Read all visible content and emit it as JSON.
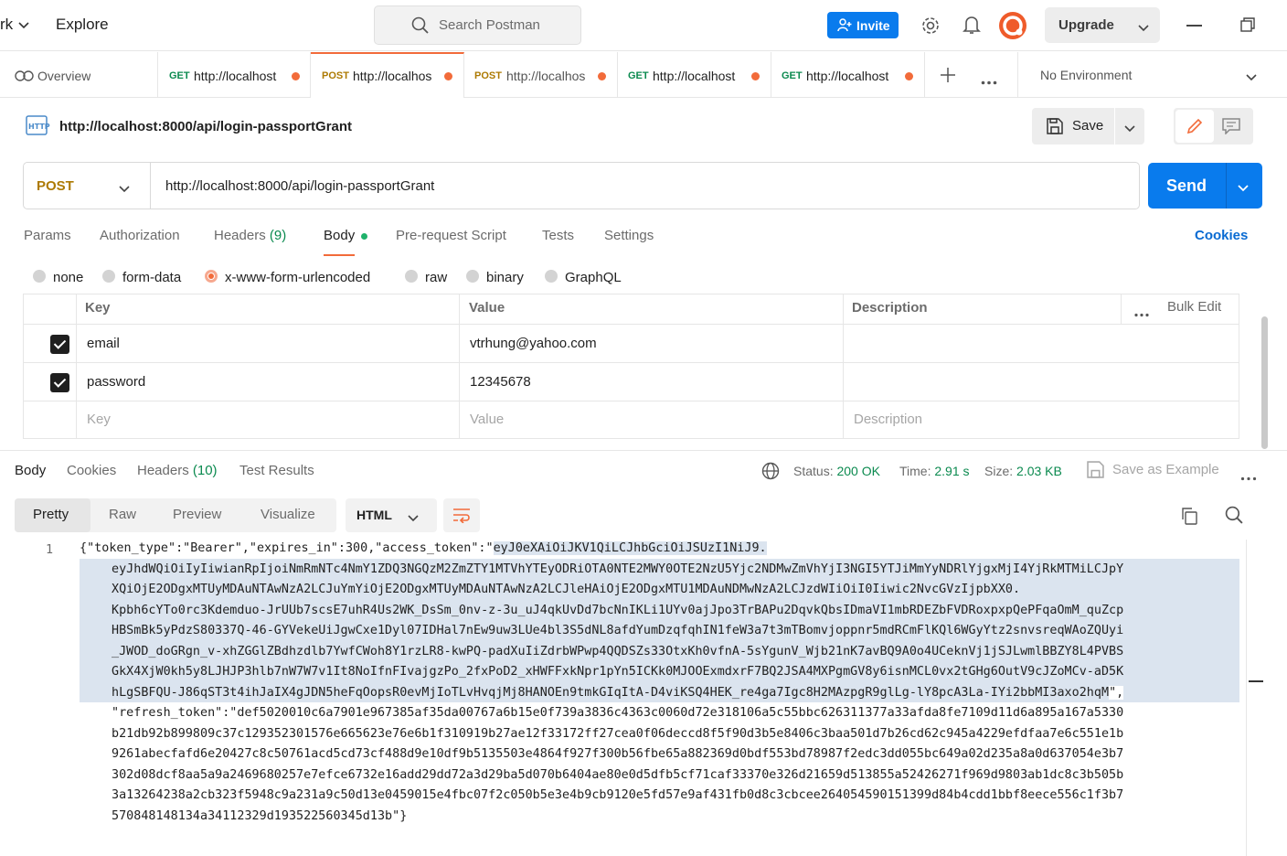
{
  "topbar": {
    "workspace_frag": "rk",
    "explore": "Explore",
    "search_placeholder": "Search Postman",
    "invite": "Invite",
    "upgrade": "Upgrade"
  },
  "tabs": {
    "overview": "Overview",
    "items": [
      {
        "method": "GET",
        "url": "http://localhost"
      },
      {
        "method": "POST",
        "url": "http://localhos"
      },
      {
        "method": "POST",
        "url": "http://localhos"
      },
      {
        "method": "GET",
        "url": "http://localhost"
      },
      {
        "method": "GET",
        "url": "http://localhost"
      }
    ],
    "environment": "No Environment"
  },
  "request": {
    "title": "http://localhost:8000/api/login-passportGrant",
    "save": "Save",
    "method": "POST",
    "url": "http://localhost:8000/api/login-passportGrant",
    "send": "Send",
    "tabs": [
      "Params",
      "Authorization",
      "Headers",
      "Body",
      "Pre-request Script",
      "Tests",
      "Settings"
    ],
    "headers_count": "(9)",
    "cookies": "Cookies",
    "body_modes": [
      "none",
      "form-data",
      "x-www-form-urlencoded",
      "raw",
      "binary",
      "GraphQL"
    ],
    "table": {
      "headers": [
        "Key",
        "Value",
        "Description"
      ],
      "bulk_edit": "Bulk Edit",
      "rows": [
        {
          "key": "email",
          "value": "vtrhung@yahoo.com"
        },
        {
          "key": "password",
          "value": "12345678"
        }
      ],
      "placeholders": {
        "key": "Key",
        "value": "Value",
        "description": "Description"
      }
    }
  },
  "response": {
    "tabs": [
      "Body",
      "Cookies",
      "Headers",
      "Test Results"
    ],
    "headers_count": "(10)",
    "status_label": "Status:",
    "status": "200 OK",
    "time_label": "Time:",
    "time": "2.91 s",
    "size_label": "Size:",
    "size": "2.03 KB",
    "save_example": "Save as Example",
    "views": [
      "Pretty",
      "Raw",
      "Preview",
      "Visualize"
    ],
    "format": "HTML",
    "line_no": "1",
    "code": {
      "l1a": "{\"token_type\":\"Bearer\",\"expires_in\":300,\"access_token\":\"",
      "l1b": "eyJ0eXAiOiJKV1QiLCJhbGciOiJSUzI1NiJ9.",
      "l2": "eyJhdWQiOiIyIiwianRpIjoiNmRmNTc4NmY1ZDQ3NGQzM2ZmZTY1MTVhYTEyODRiOTA0NTE2MWY0OTE2NzU5Yjc2NDMwZmVhYjI3NGI5YTJiMmYyNDRlYjgxMjI4YjRkMTMiLCJpY",
      "l3": "XQiOjE2ODgxMTUyMDAuNTAwNzA2LCJuYmYiOjE2ODgxMTUyMDAuNTAwNzA2LCJleHAiOjE2ODgxMTU1MDAuNDMwNzA2LCJzdWIiOiI0Iiwic2NvcGVzIjpbXX0.",
      "l4": "Kpbh6cYTo0rc3Kdemduo-JrUUb7scsE7uhR4Us2WK_DsSm_0nv-z-3u_uJ4qkUvDd7bcNnIKLi1UYv0ajJpo3TrBAPu2DqvkQbsIDmaVI1mbRDEZbFVDRoxpxpQePFqaOmM_quZcp",
      "l5": "HBSmBk5yPdzS80337Q-46-GYVekeUiJgwCxe1Dyl07IDHal7nEw9uw3LUe4bl3S5dNL8afdYumDzqfqhIN1feW3a7t3mTBomvjoppnr5mdRCmFlKQl6WGyYtz2snvsreqWAoZQUyi",
      "l6": "_JWOD_doGRgn_v-xhZGGlZBdhzdlb7YwfCWoh8Y1rzLR8-kwPQ-padXuIiZdrbWPwp4QQDSZs33OtxKh0vfnA-5sYgunV_Wjb21nK7avBQ9A0o4UCeknVj1jSJLwmlBBZY8L4PVBS",
      "l7": "GkX4XjW0kh5y8LJHJP3hlb7nW7W7v1It8NoIfnFIvajgzPo_2fxPoD2_xHWFFxkNpr1pYn5ICKk0MJOOExmdxrF7BQ2JSA4MXPgmGV8y6isnMCL0vx2tGHg6OutV9cJZoMCv-aD5K",
      "l8": "hLgSBFQU-J86qST3t4ihJaIX4gJDN5heFqOopsR0evMjIoTLvHvqjMj8HANOEn9tmkGIqItA-D4viKSQ4HEK_re4ga7Igc8H2MAzpgR9glLg-lY8pcA3La-IYi2bbMI3axo2hqM",
      "l8tail": "\",",
      "l9": "\"refresh_token\":\"def5020010c6a7901e967385af35da00767a6b15e0f739a3836c4363c0060d72e318106a5c55bbc626311377a33afda8fe7109d11d6a895a167a5330",
      "l10": "b21db92b899809c37c129352301576e665623e76e6b1f310919b27ae12f33172ff27cea0f06deccd8f5f90d3b5e8406c3baa501d7b26cd62c945a4229efdfaa7e6c551e1b",
      "l11": "9261abecfafd6e20427c8c50761acd5cd73cf488d9e10df9b5135503e4864f927f300b56fbe65a882369d0bdf553bd78987f2edc3dd055bc649a02d235a8a0d637054e3b7",
      "l12": "302d08dcf8aa5a9a2469680257e7efce6732e16add29dd72a3d29ba5d070b6404ae80e0d5dfb5cf71caf33370e326d21659d513855a52426271f969d9803ab1dc8c3b505b",
      "l13": "3a13264238a2cb323f5948c9a231a9c50d13e0459015e4fbc07f2c050b5e3e4b9cb9120e5fd57e9af431fb0d8c3cbcee264054590151399d84b4cdd1bbf8eece556c1f3b7",
      "l14": "570848148134a34112329d193522560345d13b\"}"
    }
  },
  "colors": {
    "accent": "#f26b3a",
    "primary": "#097bed",
    "success": "#0b8a4f",
    "post": "#ad7a03",
    "get": "#0b8a4f"
  }
}
